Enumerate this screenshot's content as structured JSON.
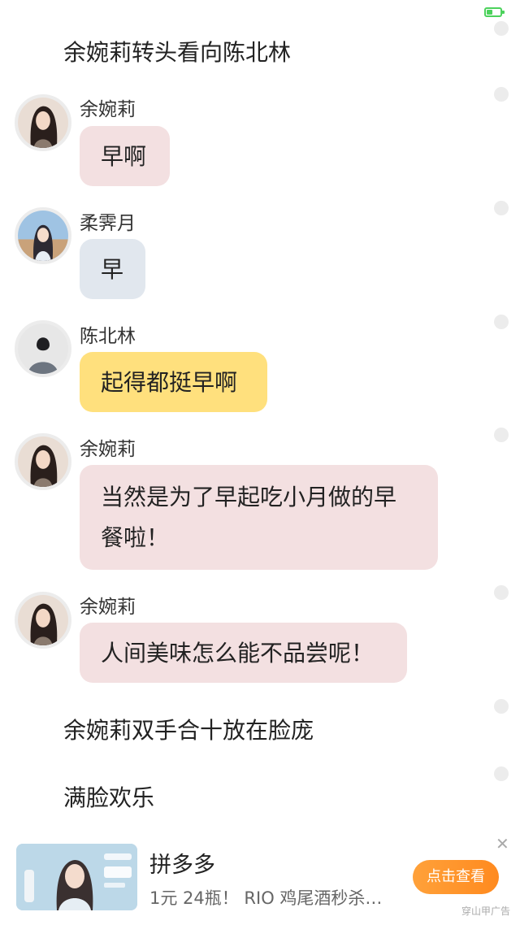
{
  "status_bar": {
    "battery_level": 0.45,
    "battery_color": "#4cd25c"
  },
  "messages": [
    {
      "type": "narration",
      "text": "余婉莉转头看向陈北林"
    },
    {
      "type": "chat",
      "sender": "余婉莉",
      "text": "早啊",
      "bubble_color": "#f3e0e1"
    },
    {
      "type": "chat",
      "sender": "柔霁月",
      "text": "早",
      "bubble_color": "#e1e7ee"
    },
    {
      "type": "chat",
      "sender": "陈北林",
      "text": "起得都挺早啊",
      "bubble_color": "#ffe07d"
    },
    {
      "type": "chat",
      "sender": "余婉莉",
      "text_line1": "当然是为了早起吃小月做的早",
      "text_line2": "餐啦！",
      "bubble_color": "#f3e0e1"
    },
    {
      "type": "chat",
      "sender": "余婉莉",
      "text": "人间美味怎么能不品尝呢！",
      "bubble_color": "#f3e0e1"
    },
    {
      "type": "narration",
      "text": "余婉莉双手合十放在脸庞"
    },
    {
      "type": "narration",
      "text": "满脸欢乐"
    }
  ],
  "ad": {
    "title": "拼多多",
    "description": "1元 24瓶！ RIO 鸡尾酒秒杀…",
    "button_label": "点击查看",
    "source": "穿山甲广告",
    "close_icon": "close-icon",
    "button_color": "#ff9a2e"
  }
}
